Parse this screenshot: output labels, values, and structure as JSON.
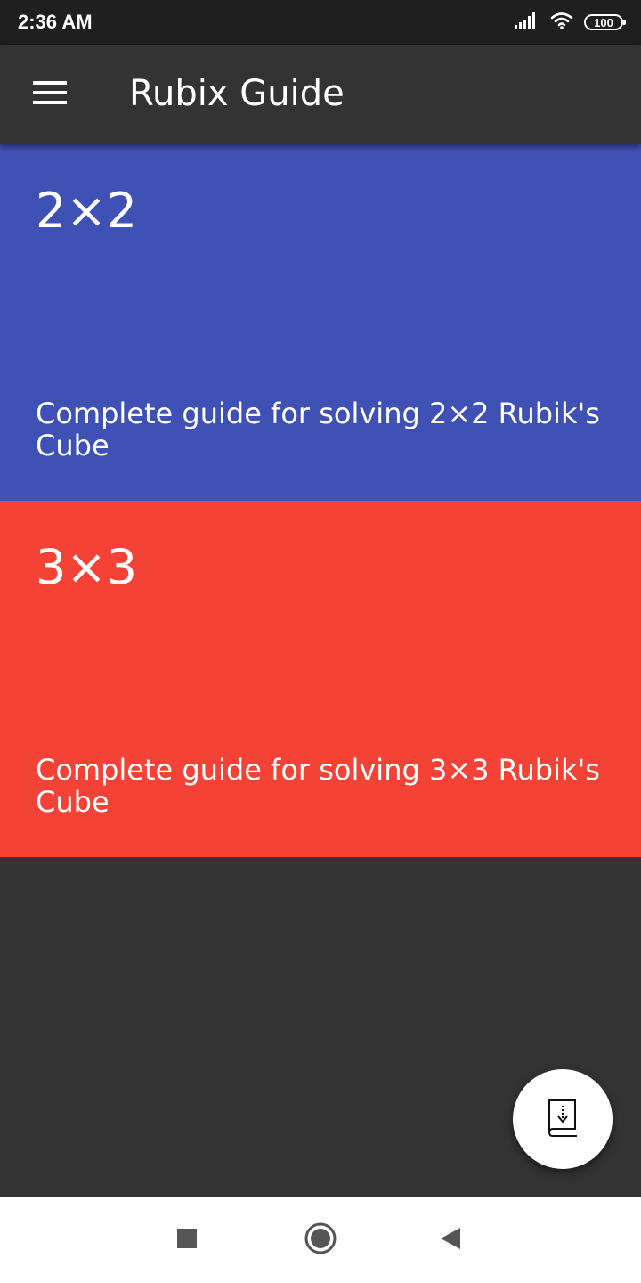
{
  "status_bar": {
    "time": "2:36 AM",
    "battery": "100",
    "icons": [
      "signal-icon",
      "wifi-icon",
      "battery-icon"
    ]
  },
  "app_bar": {
    "title": "Rubix Guide",
    "menu_icon": "hamburger-menu-icon"
  },
  "cards": [
    {
      "title": "2×2",
      "description": "Complete guide for solving 2×2 Rubik's Cube",
      "color": "#3f51b5"
    },
    {
      "title": "3×3",
      "description": "Complete guide for solving 3×3 Rubik's Cube",
      "color": "#f44336"
    }
  ],
  "fab": {
    "icon": "book-download-icon"
  },
  "nav_bar": {
    "icons": [
      "recents-square-icon",
      "home-circle-icon",
      "back-triangle-icon"
    ]
  },
  "colors": {
    "background": "#333333",
    "status_bar": "#1f1f1f",
    "nav_bar": "#ffffff"
  }
}
